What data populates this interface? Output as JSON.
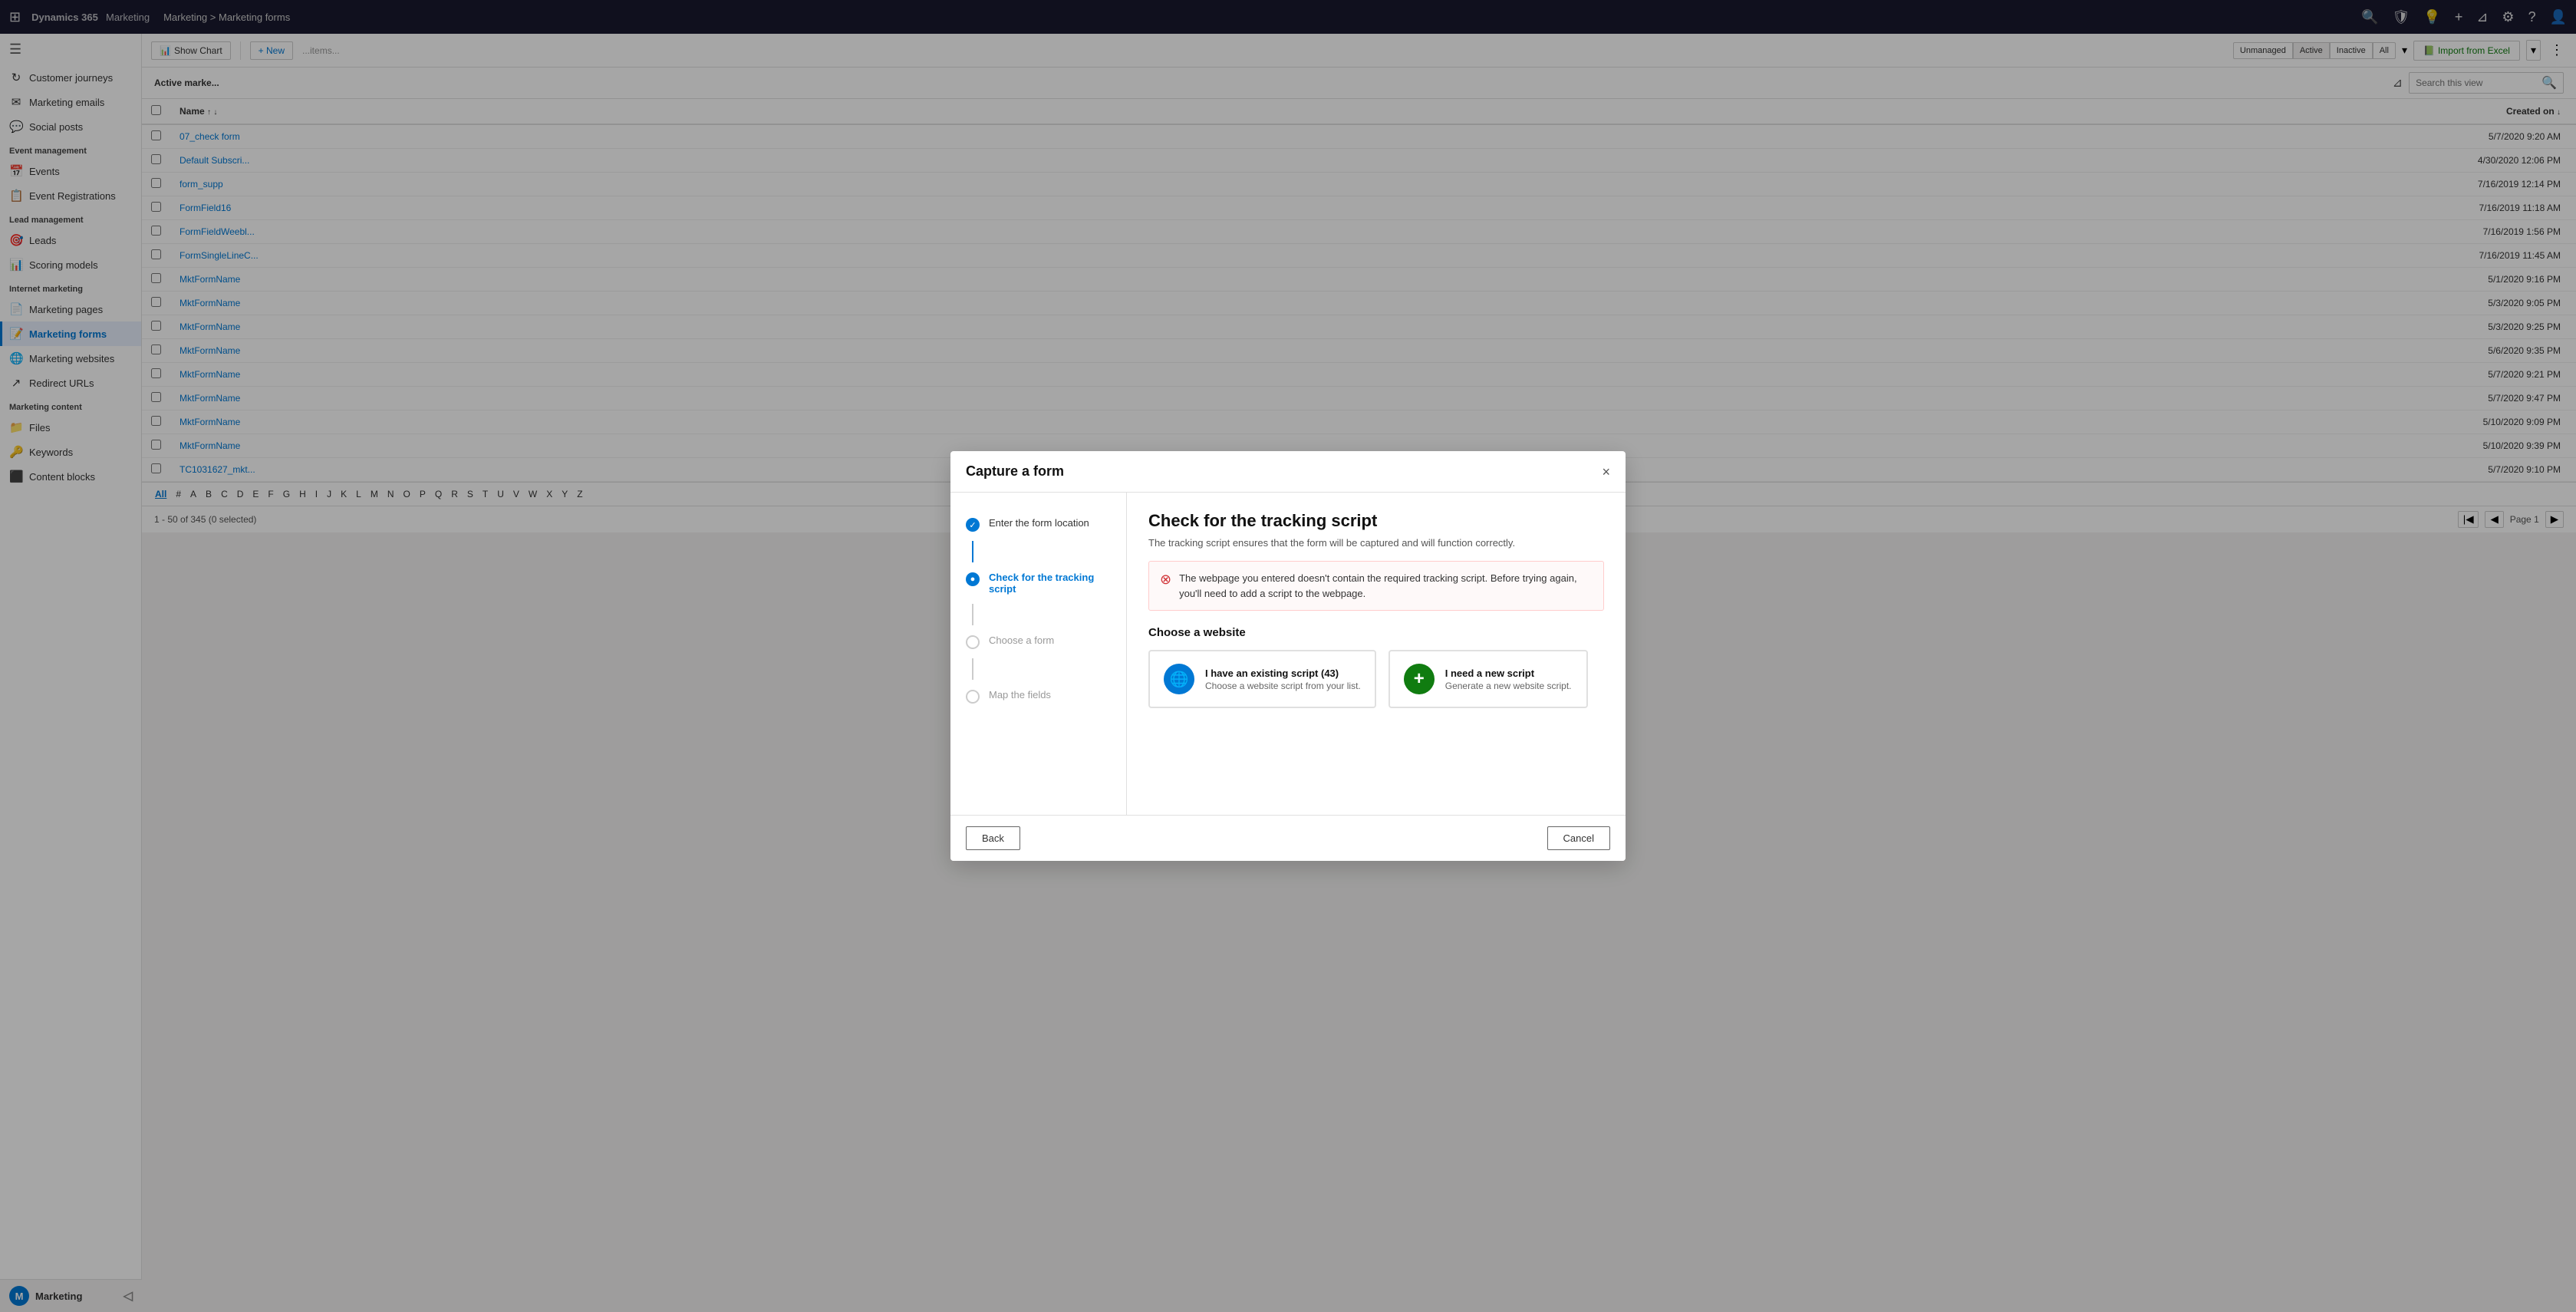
{
  "app": {
    "brand": "Dynamics 365",
    "module": "Marketing",
    "breadcrumb_parent": "Marketing",
    "breadcrumb_sep": ">",
    "breadcrumb_current": "Marketing forms"
  },
  "nav_icons": [
    "🔍",
    "🛡",
    "💡",
    "+",
    "⊿",
    "⚙",
    "?",
    "👤"
  ],
  "sidebar": {
    "toggle_icon": "☰",
    "sections": [
      {
        "items": [
          {
            "label": "Customer journeys",
            "icon": "↻",
            "active": false
          },
          {
            "label": "Marketing emails",
            "icon": "✉",
            "active": false
          },
          {
            "label": "Social posts",
            "icon": "💬",
            "active": false
          }
        ]
      },
      {
        "header": "Event management",
        "items": [
          {
            "label": "Events",
            "icon": "📅",
            "active": false
          },
          {
            "label": "Event Registrations",
            "icon": "📋",
            "active": false
          }
        ]
      },
      {
        "header": "Lead management",
        "items": [
          {
            "label": "Leads",
            "icon": "🎯",
            "active": false
          },
          {
            "label": "Scoring models",
            "icon": "📊",
            "active": false
          }
        ]
      },
      {
        "header": "Internet marketing",
        "items": [
          {
            "label": "Marketing pages",
            "icon": "📄",
            "active": false
          },
          {
            "label": "Marketing forms",
            "icon": "📝",
            "active": true
          },
          {
            "label": "Marketing websites",
            "icon": "🌐",
            "active": false
          },
          {
            "label": "Redirect URLs",
            "icon": "↗",
            "active": false
          }
        ]
      },
      {
        "header": "Marketing content",
        "items": [
          {
            "label": "Files",
            "icon": "📁",
            "active": false
          },
          {
            "label": "Keywords",
            "icon": "🔑",
            "active": false
          },
          {
            "label": "Content blocks",
            "icon": "⬛",
            "active": false
          }
        ]
      }
    ]
  },
  "toolbar": {
    "show_chart_label": "Show Chart",
    "new_label": "+ New",
    "tabs": [
      "Unmanaged",
      "Active",
      "Inactive",
      "All"
    ],
    "import_label": "Import from Excel",
    "filter_icon": "⊿",
    "search_placeholder": "Search this view",
    "more_icon": "⋮"
  },
  "page": {
    "title": "Active marke...",
    "record_count": "1 - 50 of 345 (0 selected)",
    "page_label": "Page 1",
    "column_name": "Name",
    "column_created": "Created on"
  },
  "table_rows": [
    {
      "name": "07_check form",
      "created": "5/7/2020 9:20 AM"
    },
    {
      "name": "Default Subscri...",
      "created": "4/30/2020 12:06 PM"
    },
    {
      "name": "form_supp",
      "created": "7/16/2019 12:14 PM"
    },
    {
      "name": "FormField16",
      "created": "7/16/2019 11:18 AM"
    },
    {
      "name": "FormFieldWeebl...",
      "created": "7/16/2019 1:56 PM"
    },
    {
      "name": "FormSingleLineC...",
      "created": "7/16/2019 11:45 AM"
    },
    {
      "name": "MktFormName",
      "created": "5/1/2020 9:16 PM"
    },
    {
      "name": "MktFormName",
      "created": "5/3/2020 9:05 PM"
    },
    {
      "name": "MktFormName",
      "created": "5/3/2020 9:25 PM"
    },
    {
      "name": "MktFormName",
      "created": "5/6/2020 9:35 PM"
    },
    {
      "name": "MktFormName",
      "created": "5/7/2020 9:21 PM"
    },
    {
      "name": "MktFormName",
      "created": "5/7/2020 9:47 PM"
    },
    {
      "name": "MktFormName",
      "created": "5/10/2020 9:09 PM"
    },
    {
      "name": "MktFormName",
      "created": "5/10/2020 9:39 PM"
    },
    {
      "name": "TC1031627_mkt...",
      "created": "5/7/2020 9:10 PM"
    }
  ],
  "alphabet": [
    "All",
    "#",
    "A",
    "B",
    "C",
    "D",
    "E",
    "F",
    "G",
    "H",
    "I",
    "J",
    "K",
    "L",
    "M",
    "N",
    "O",
    "P",
    "Q",
    "R",
    "S",
    "T",
    "U",
    "V",
    "W",
    "X",
    "Y",
    "Z"
  ],
  "alphabet_active": "All",
  "modal": {
    "title": "Capture a form",
    "close_label": "×",
    "steps": [
      {
        "label": "Enter the form location",
        "status": "completed"
      },
      {
        "label": "Check for the tracking script",
        "status": "active"
      },
      {
        "label": "Choose a form",
        "status": "pending"
      },
      {
        "label": "Map the fields",
        "status": "pending"
      }
    ],
    "content": {
      "title": "Check for the tracking script",
      "description": "The tracking script ensures that the form will be captured and will function correctly.",
      "error_message": "The webpage you entered doesn't contain the required tracking script. Before trying again, you'll need to add a script to the webpage.",
      "choose_website_label": "Choose a website",
      "option1_label": "I have an existing script (43)",
      "option1_desc": "Choose a website script from your list.",
      "option1_icon": "🌐",
      "option2_label": "I need a new script",
      "option2_desc": "Generate a new website script.",
      "option2_icon": "+"
    },
    "back_label": "Back",
    "cancel_label": "Cancel"
  }
}
